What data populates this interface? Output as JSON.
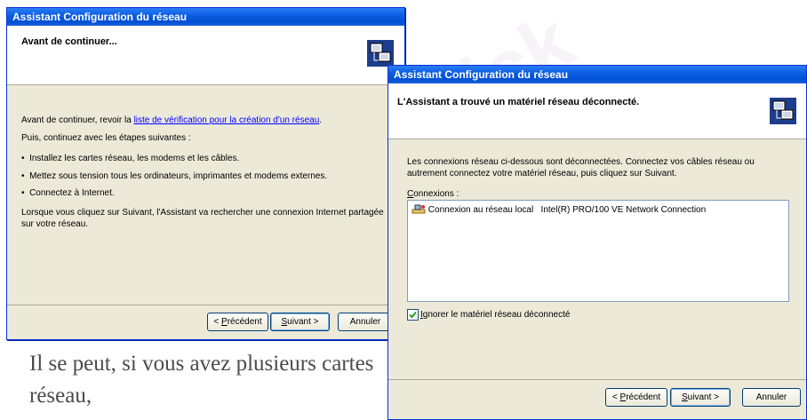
{
  "background": {
    "caption": "Il se peut, si vous avez plusieurs cartes réseau,"
  },
  "window1": {
    "title": "Assistant Configuration du réseau",
    "header_title": "Avant de continuer...",
    "intro_text": "Avant de continuer, revoir la ",
    "intro_link": "liste de vérification pour la création d'un réseau",
    "intro_end": ".",
    "steps_intro": "Puis, continuez avec les étapes suivantes :",
    "bullets": [
      "Installez les cartes réseau, les modems et les câbles.",
      "Mettez sous tension tous les ordinateurs, imprimantes et modems externes.",
      "Connectez à Internet."
    ],
    "next_info": "Lorsque vous cliquez sur Suivant, l'Assistant va rechercher une connexion Internet partagée sur votre réseau.",
    "btn_back_prefix": "< ",
    "btn_back_u": "P",
    "btn_back_rest": "récédent",
    "btn_next_u": "S",
    "btn_next_rest": "uivant >",
    "btn_cancel": "Annuler"
  },
  "window2": {
    "title": "Assistant Configuration du réseau",
    "header_title": "L'Assistant a trouvé un matériel réseau déconnecté.",
    "description": "Les connexions réseau ci-dessous sont déconnectées. Connectez vos câbles réseau ou autrement connectez votre matériel réseau, puis cliquez sur Suivant.",
    "connections_label_u": "C",
    "connections_label_rest": "onnexions :",
    "connection_name": "Connexion au réseau local",
    "connection_device": "Intel(R) PRO/100 VE Network Connection",
    "ignore_u": "I",
    "ignore_rest": "gnorer le matériel réseau déconnecté",
    "ignore_checked": true,
    "btn_back_prefix": "< ",
    "btn_back_u": "P",
    "btn_back_rest": "récédent",
    "btn_next_u": "S",
    "btn_next_rest": "uivant >",
    "btn_cancel": "Annuler"
  },
  "colors": {
    "titlebar": "#0a5be0",
    "dialog_face": "#ece9d8",
    "link": "#0000ff"
  }
}
